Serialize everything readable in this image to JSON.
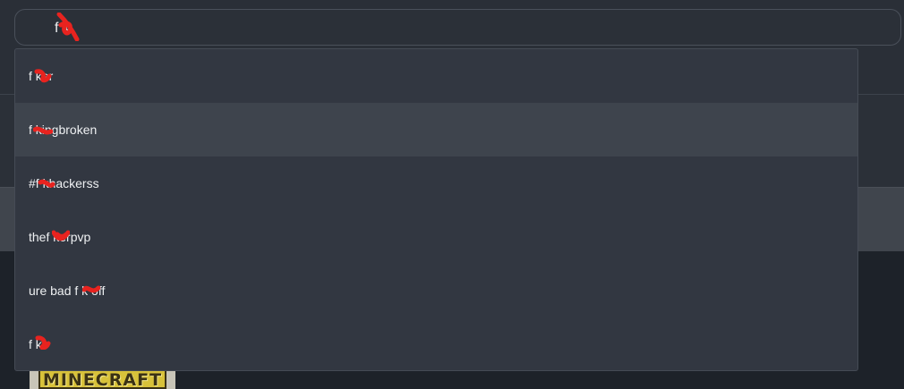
{
  "search": {
    "value": "f  k"
  },
  "suggestions": [
    "f  ker",
    "f  kingbroken",
    "#f  khackerss",
    "thef  kerpvp",
    "ure bad f  k off",
    "f  k"
  ],
  "background": {
    "thumbnail_logo": "MINECRAFT"
  },
  "colors": {
    "censor": "#e8231f",
    "dropdown_bg": "#323741",
    "hover_bg": "#3e444d"
  }
}
